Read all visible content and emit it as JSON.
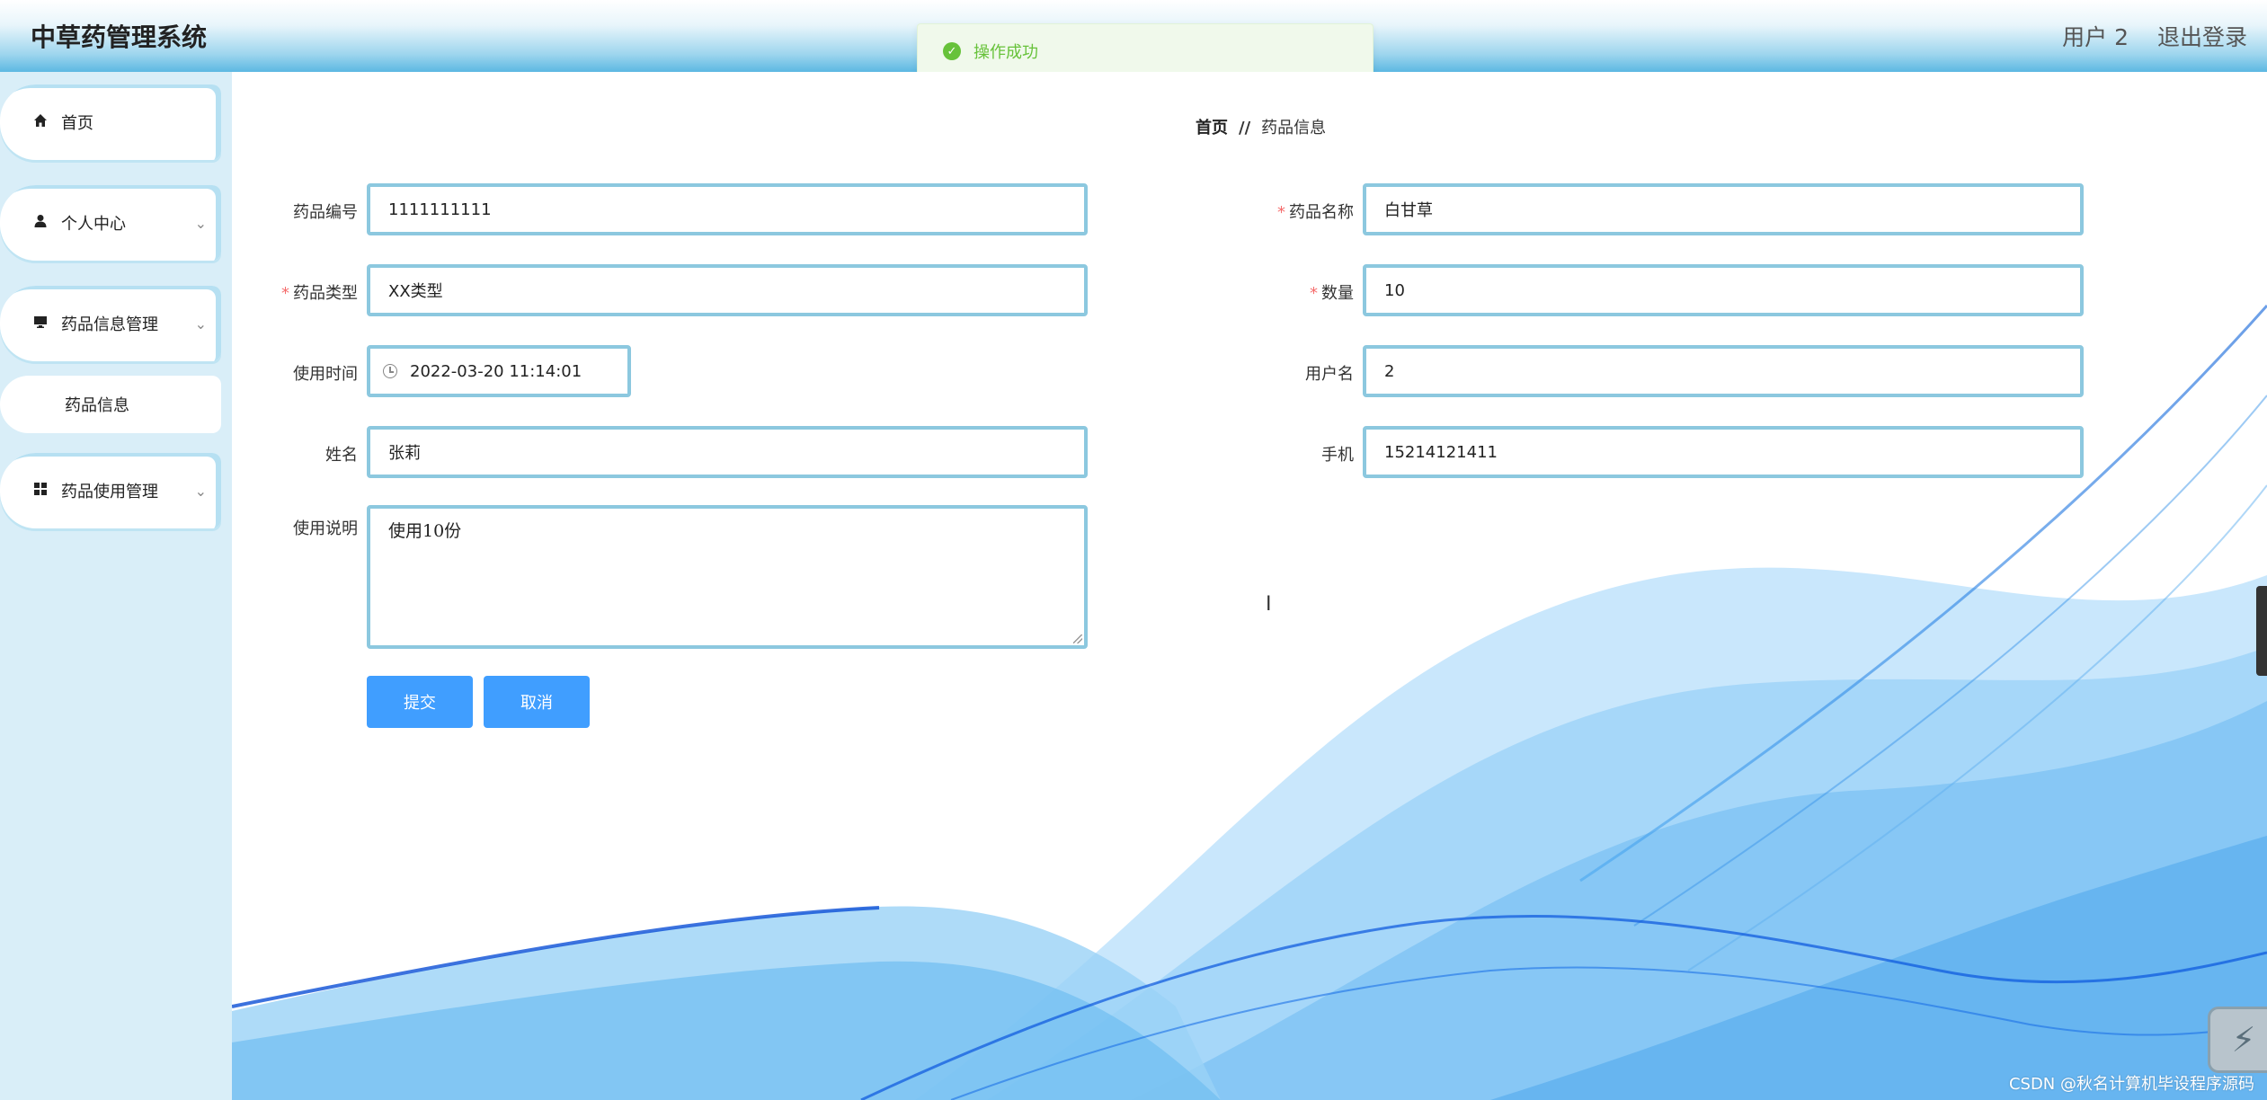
{
  "header": {
    "app_title": "中草药管理系统",
    "user_label": "用户 2",
    "logout_label": "退出登录"
  },
  "toast": {
    "message": "操作成功",
    "icon": "check-circle-icon"
  },
  "sidebar": {
    "items": [
      {
        "label": "首页",
        "icon": "home-icon"
      },
      {
        "label": "个人中心",
        "icon": "user-icon"
      },
      {
        "label": "药品信息管理",
        "icon": "monitor-icon"
      },
      {
        "label": "药品信息",
        "icon": ""
      },
      {
        "label": "药品使用管理",
        "icon": "grid-icon"
      }
    ]
  },
  "breadcrumb": {
    "home": "首页",
    "separator": "//",
    "current": "药品信息"
  },
  "form": {
    "code": {
      "label": "药品编号",
      "value": "1111111111",
      "required": false
    },
    "name": {
      "label": "药品名称",
      "value": "白甘草",
      "required": true
    },
    "type": {
      "label": "药品类型",
      "value": "XX类型",
      "required": true
    },
    "quantity": {
      "label": "数量",
      "value": "10",
      "required": true
    },
    "use_time": {
      "label": "使用时间",
      "value": "2022-03-20 11:14:01",
      "required": false
    },
    "username": {
      "label": "用户名",
      "value": "2",
      "required": false
    },
    "realname": {
      "label": "姓名",
      "value": "张莉",
      "required": false
    },
    "phone": {
      "label": "手机",
      "value": "15214121411",
      "required": false
    },
    "notes": {
      "label": "使用说明",
      "value": "使用10份",
      "required": false
    },
    "required_mark": "*"
  },
  "buttons": {
    "submit": "提交",
    "cancel": "取消"
  },
  "watermark": "CSDN @秋名计算机毕设程序源码",
  "colors": {
    "accent": "#409eff",
    "input_border": "#8cc8df",
    "success": "#67c23a",
    "required": "#f56c6c"
  }
}
